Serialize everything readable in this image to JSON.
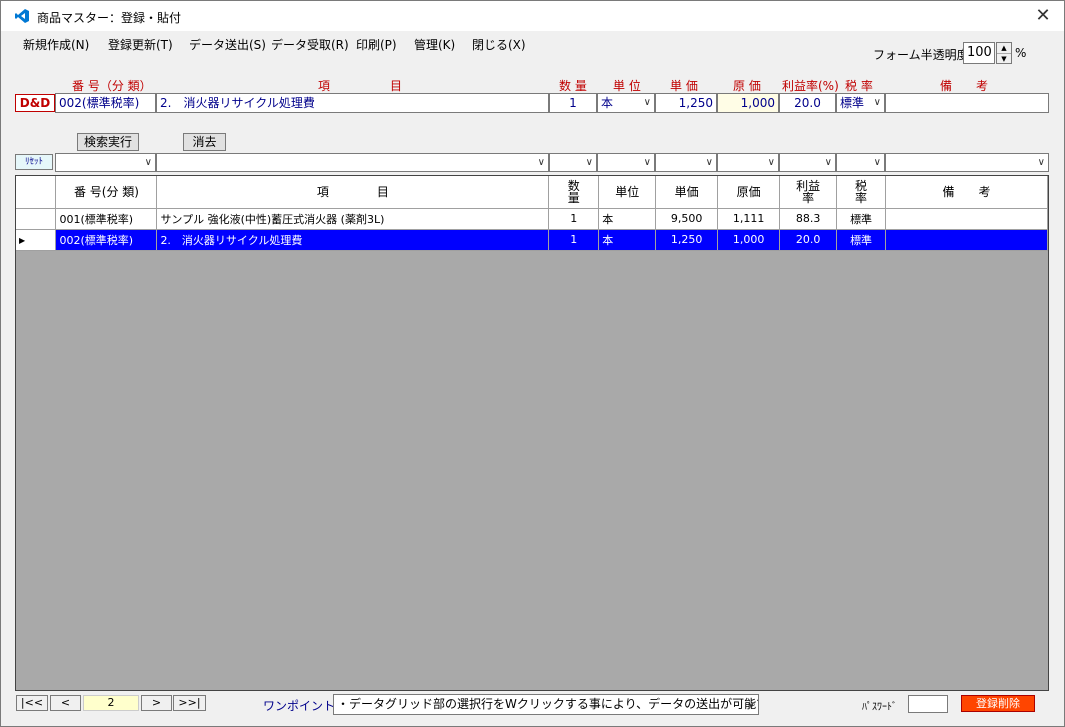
{
  "window": {
    "title": "商品マスター：登録・貼付",
    "close": "✕"
  },
  "menu": [
    "新規作成(N)",
    "登録更新(T)",
    "データ送出(S)",
    "データ受取(R)",
    "印刷(P)",
    "管理(K)",
    "閉じる(X)"
  ],
  "opacity": {
    "label": "フォーム半透明度",
    "value": "100",
    "unit": "%"
  },
  "entry_headers": {
    "code": "番 号（分 類）",
    "item": "項　　　　　目",
    "qty": "数 量",
    "unit": "単 位",
    "price": "単 価",
    "cost": "原 価",
    "margin": "利益率(%)",
    "tax": "税 率",
    "note": "備　　考"
  },
  "entry": {
    "brand": "D&D",
    "code": "002(標準税率)",
    "item": "2.　消火器リサイクル処理費",
    "qty": "1",
    "unit": "本",
    "price": "1,250",
    "cost": "1,000",
    "margin": "20.0",
    "tax": "標準",
    "note": ""
  },
  "buttons": {
    "search": "検索実行",
    "clear": "消去",
    "reset": "ﾘｾｯﾄ"
  },
  "grid": {
    "headers": {
      "code": "番 号(分 類)",
      "item": "項　　　　目",
      "qty": "数\n量",
      "unit": "単位",
      "price": "単価",
      "cost": "原価",
      "margin": "利益\n率",
      "tax": "税\n率",
      "note": "備　　考"
    },
    "rows": [
      {
        "code": "001(標準税率)",
        "item": "サンプル 強化液(中性)蓄圧式消火器 (薬剤3L)",
        "qty": "1",
        "unit": "本",
        "price": "9,500",
        "cost": "1,111",
        "margin": "88.3",
        "tax": "標準",
        "note": "",
        "selected": false
      },
      {
        "code": "002(標準税率)",
        "item": "2.　消火器リサイクル処理費",
        "qty": "1",
        "unit": "本",
        "price": "1,250",
        "cost": "1,000",
        "margin": "20.0",
        "tax": "標準",
        "note": "",
        "selected": true
      }
    ]
  },
  "footer": {
    "first": "|<<",
    "prev": "<",
    "page": "2",
    "next": ">",
    "last": ">>|",
    "tip_label": "ワンポイント:",
    "tip": "・データグリッド部の選択行をWクリックする事により、データの送出が可能です。",
    "password_label": "ﾊﾟｽﾜｰﾄﾞ",
    "delete": "登録削除"
  },
  "colors": {
    "accent_red": "#c00000",
    "selection": "#0000ff",
    "entry_text": "#00008b",
    "delete": "#ff4500"
  },
  "icons": {
    "app": "vscode-like-icon",
    "close": "close-icon"
  }
}
